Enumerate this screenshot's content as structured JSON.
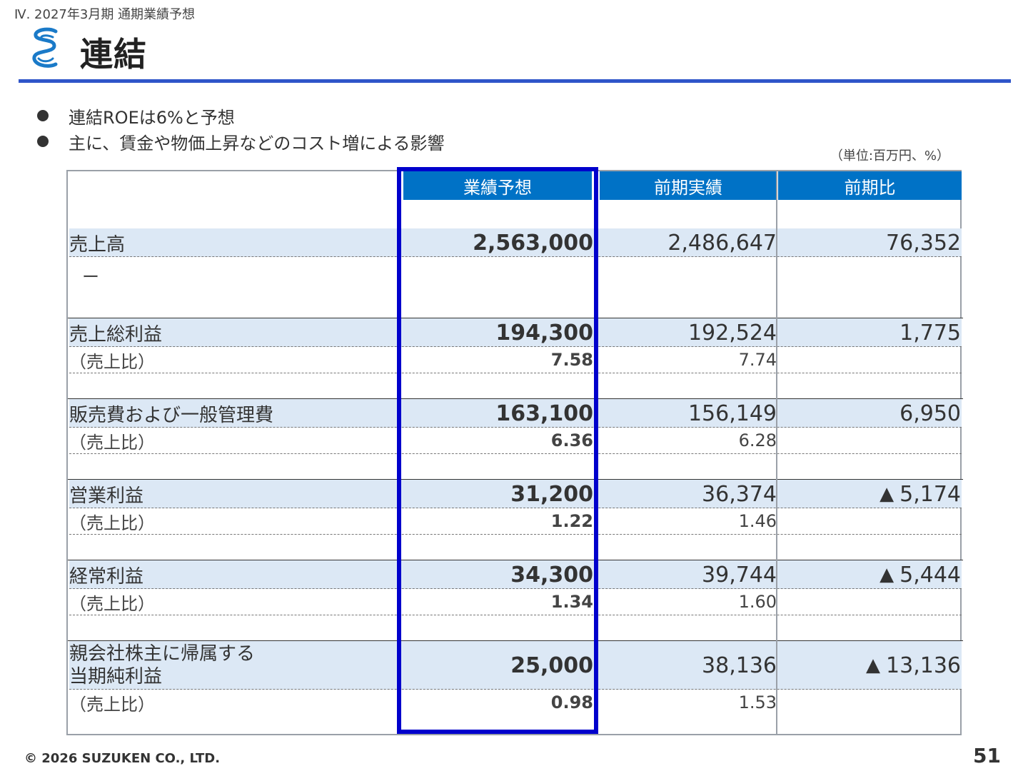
{
  "header": {
    "section": "Ⅳ. 2027年3月期 通期業績予想",
    "title": "連結"
  },
  "bullets": [
    "連結ROEは6%と予想",
    "主に、賃金や物価上昇などのコスト増による影響"
  ],
  "unit_note": "（単位:百万円、%）",
  "table": {
    "columns": [
      "業績予想",
      "前期実績",
      "前期比"
    ],
    "dash": "ー",
    "ratio_label": "（売上比）",
    "triangle": "▲",
    "rows": [
      {
        "label": "売上高",
        "forecast": "2,563,000",
        "prior": "2,486,647",
        "change": "76,352"
      },
      {
        "label": "売上総利益",
        "forecast": "194,300",
        "prior": "192,524",
        "change": "1,775",
        "ratio_forecast": "7.58",
        "ratio_prior": "7.74"
      },
      {
        "label": "販売費および一般管理費",
        "forecast": "163,100",
        "prior": "156,149",
        "change": "6,950",
        "ratio_forecast": "6.36",
        "ratio_prior": "6.28"
      },
      {
        "label": "営業利益",
        "forecast": "31,200",
        "prior": "36,374",
        "change": "5,174",
        "ratio_forecast": "1.22",
        "ratio_prior": "1.46"
      },
      {
        "label": "経常利益",
        "forecast": "34,300",
        "prior": "39,744",
        "change": "5,444",
        "ratio_forecast": "1.34",
        "ratio_prior": "1.60"
      },
      {
        "label_line1": "親会社株主に帰属する",
        "label_line2": "当期純利益",
        "forecast": "25,000",
        "prior": "38,136",
        "change": "13,136",
        "ratio_forecast": "0.98",
        "ratio_prior": "1.53"
      }
    ]
  },
  "footer": {
    "copyright": "© 2026 SUZUKEN CO., LTD.",
    "page": "51"
  },
  "colors": {
    "accent_rule": "#2f55c9",
    "header_fill": "#0072c6",
    "row_band": "#dce8f5",
    "highlight_box": "#0000cc"
  }
}
